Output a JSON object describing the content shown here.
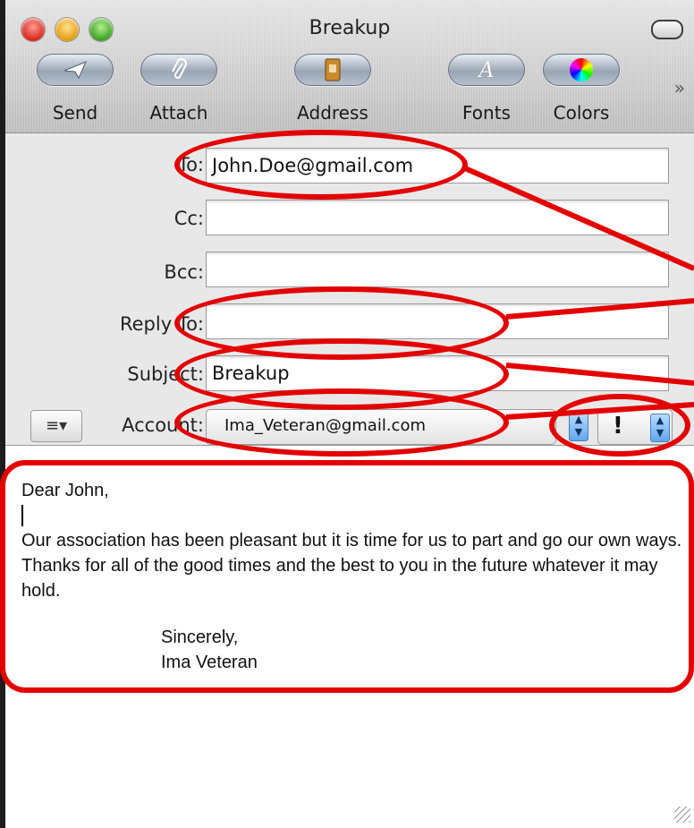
{
  "window": {
    "title": "Breakup"
  },
  "toolbar": [
    {
      "label": "Send",
      "icon": "send-icon"
    },
    {
      "label": "Attach",
      "icon": "paperclip-icon"
    },
    {
      "label": "Address",
      "icon": "address-book-icon"
    },
    {
      "label": "Fonts",
      "icon": "fonts-icon"
    },
    {
      "label": "Colors",
      "icon": "color-wheel-icon"
    }
  ],
  "toolbar_overflow": "»",
  "headers": {
    "to_label": "To:",
    "to_value": "John.Doe@gmail.com",
    "cc_label": "Cc:",
    "cc_value": "",
    "bcc_label": "Bcc:",
    "bcc_value": "",
    "replyto_label": "Reply To:",
    "replyto_value": "",
    "subject_label": "Subject:",
    "subject_value": "Breakup",
    "account_label": "Account:",
    "account_value": "Ima_Veteran@gmail.com",
    "priority_value": "!"
  },
  "message": {
    "greeting": "Dear John,",
    "paragraph": "Our association has been pleasant but it is time for us to part and go our own ways. Thanks for all of the good times and the best to you in the future whatever it may hold.",
    "closing": "Sincerely,",
    "signature": "Ima Veteran"
  },
  "colors": {
    "annotation": "#e30000",
    "background": "#1c1c1c"
  }
}
